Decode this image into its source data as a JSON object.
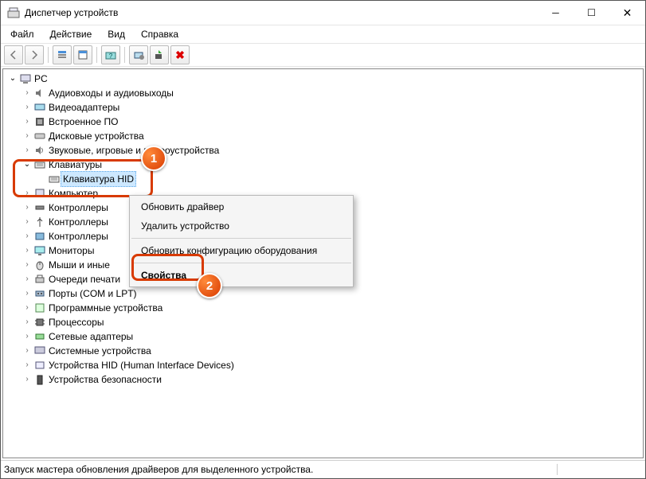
{
  "window": {
    "title": "Диспетчер устройств"
  },
  "menu": {
    "file": "Файл",
    "action": "Действие",
    "view": "Вид",
    "help": "Справка"
  },
  "tree": {
    "root": "PC",
    "items": [
      "Аудиовходы и аудиовыходы",
      "Видеоадаптеры",
      "Встроенное ПО",
      "Дисковые устройства",
      "Звуковые, игровые и видеоустройства",
      "Клавиатуры",
      "Компьютер",
      "Контроллеры",
      "Контроллеры",
      "Контроллеры",
      "Мониторы",
      "Мыши и иные",
      "Очереди печати",
      "Порты (COM и LPT)",
      "Программные устройства",
      "Процессоры",
      "Сетевые адаптеры",
      "Системные устройства",
      "Устройства HID (Human Interface Devices)",
      "Устройства безопасности"
    ],
    "keyboard_child": "Клавиатура HID"
  },
  "context": {
    "update": "Обновить драйвер",
    "remove": "Удалить устройство",
    "rescan": "Обновить конфигурацию оборудования",
    "props": "Свойства"
  },
  "badges": {
    "one": "1",
    "two": "2"
  },
  "status": "Запуск мастера обновления драйверов для выделенного устройства."
}
